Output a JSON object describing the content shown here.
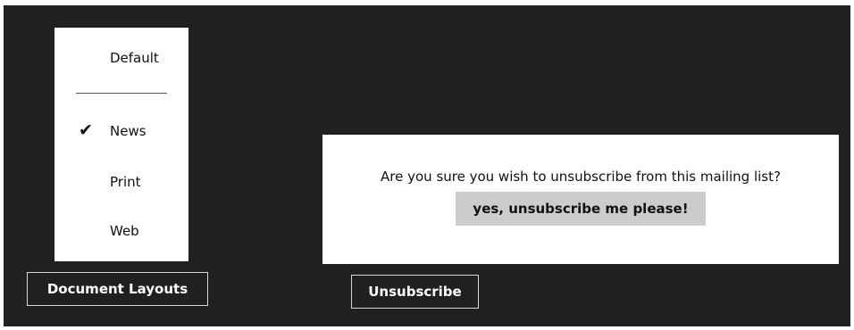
{
  "layout_menu": {
    "items": [
      {
        "label": "Default",
        "checked": false
      },
      {
        "label": "News",
        "checked": true
      },
      {
        "label": "Print",
        "checked": false
      },
      {
        "label": "Web",
        "checked": false
      }
    ],
    "check_glyph": "✔"
  },
  "buttons": {
    "document_layouts": "Document Layouts",
    "unsubscribe": "Unsubscribe"
  },
  "unsubscribe_flyout": {
    "message": "Are you sure you wish to unsubscribe from this mailing list?",
    "confirm_label": "yes, unsubscribe me please!"
  },
  "colors": {
    "app_background": "#202020",
    "flyout_background": "#ffffff",
    "confirm_button_background": "#cccccc",
    "button_border": "#d8d8d8"
  }
}
